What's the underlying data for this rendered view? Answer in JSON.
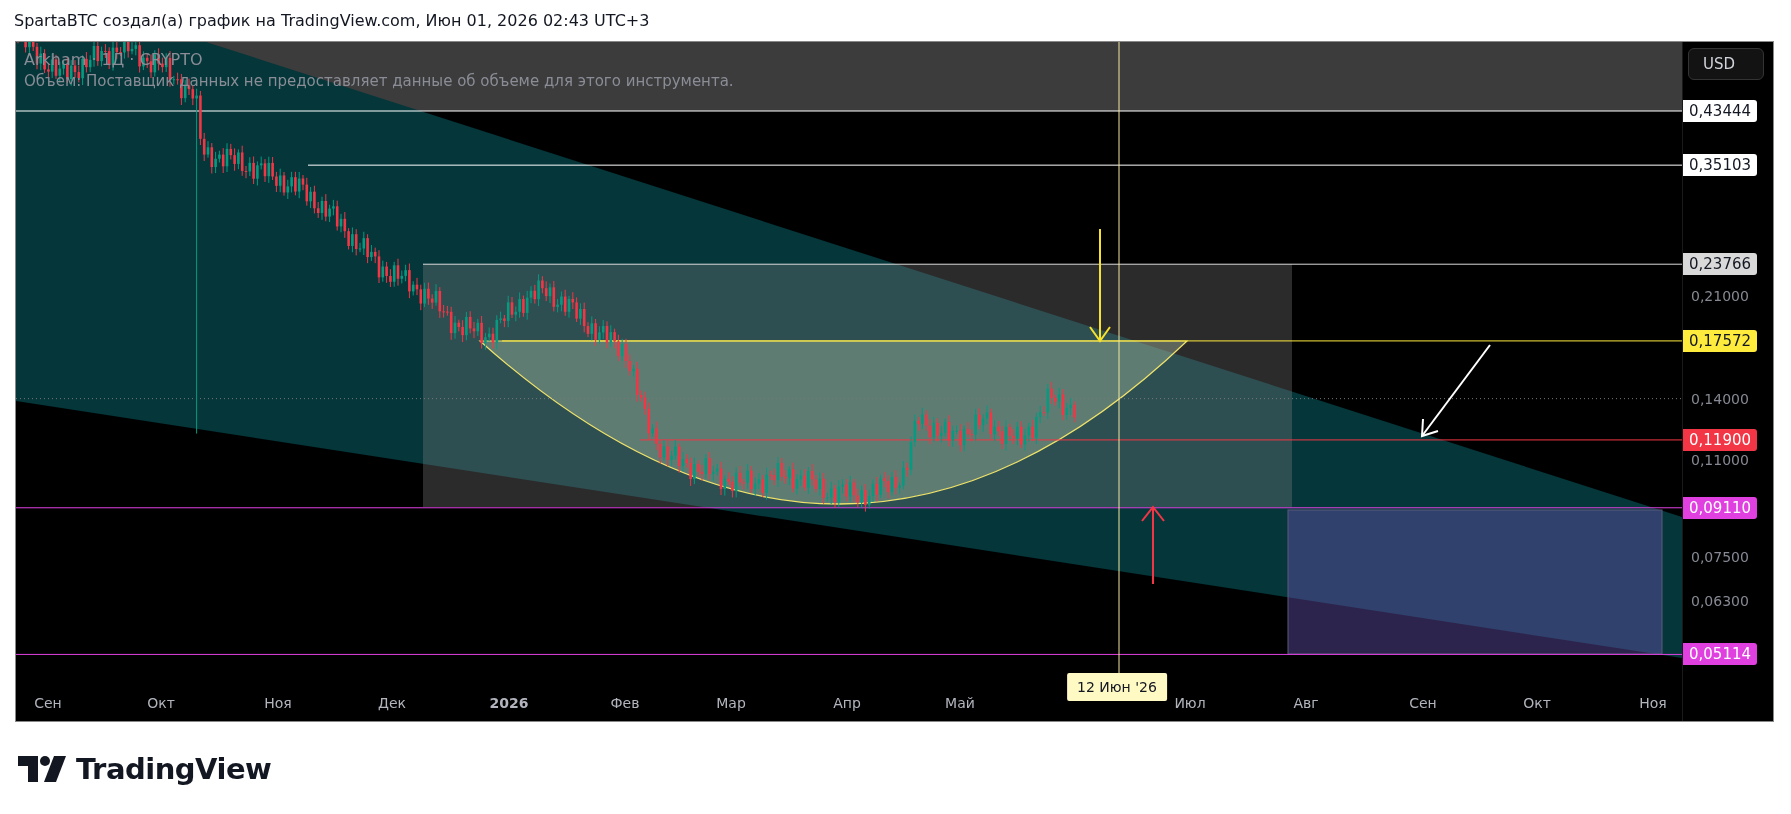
{
  "header": {
    "text": "SpartaBTC создал(а) график на TradingView.com, Июн 01, 2026 02:43 UTC+3"
  },
  "chart": {
    "symbol": "Arkham · 1Д · CRYPTO",
    "volume_note": "Объем: Поставщик данных не предоставляет данные об объеме для этого инструмента.",
    "currency": "USD",
    "price_ticks": [
      "0,21000",
      "0,14000",
      "0,11000",
      "0,07500",
      "0,06300"
    ],
    "price_markers": [
      {
        "label": "0,43444",
        "color": "#ffffff"
      },
      {
        "label": "0,35103",
        "color": "#ffffff"
      },
      {
        "label": "0,23766",
        "color": "#d9d9d9"
      },
      {
        "label": "0,17572",
        "color": "#ffeb3b"
      },
      {
        "label": "0,11900",
        "color": "#f23645"
      },
      {
        "label": "0,09110",
        "color": "#e040e0"
      },
      {
        "label": "0,05114",
        "color": "#e040e0"
      }
    ],
    "time_labels": [
      {
        "label": "Сен",
        "kind": "month"
      },
      {
        "label": "Окт",
        "kind": "month"
      },
      {
        "label": "Ноя",
        "kind": "month"
      },
      {
        "label": "Дек",
        "kind": "month"
      },
      {
        "label": "2026",
        "kind": "year"
      },
      {
        "label": "Фев",
        "kind": "month"
      },
      {
        "label": "Мар",
        "kind": "month"
      },
      {
        "label": "Апр",
        "kind": "month"
      },
      {
        "label": "Май",
        "kind": "month"
      },
      {
        "label": "Июл",
        "kind": "month"
      },
      {
        "label": "Авг",
        "kind": "month"
      },
      {
        "label": "Сен",
        "kind": "month"
      },
      {
        "label": "Окт",
        "kind": "month"
      },
      {
        "label": "Ноя",
        "kind": "month"
      }
    ],
    "crosshair_label": "12 Июн '26"
  },
  "footer": {
    "brand": "TradingView"
  }
}
